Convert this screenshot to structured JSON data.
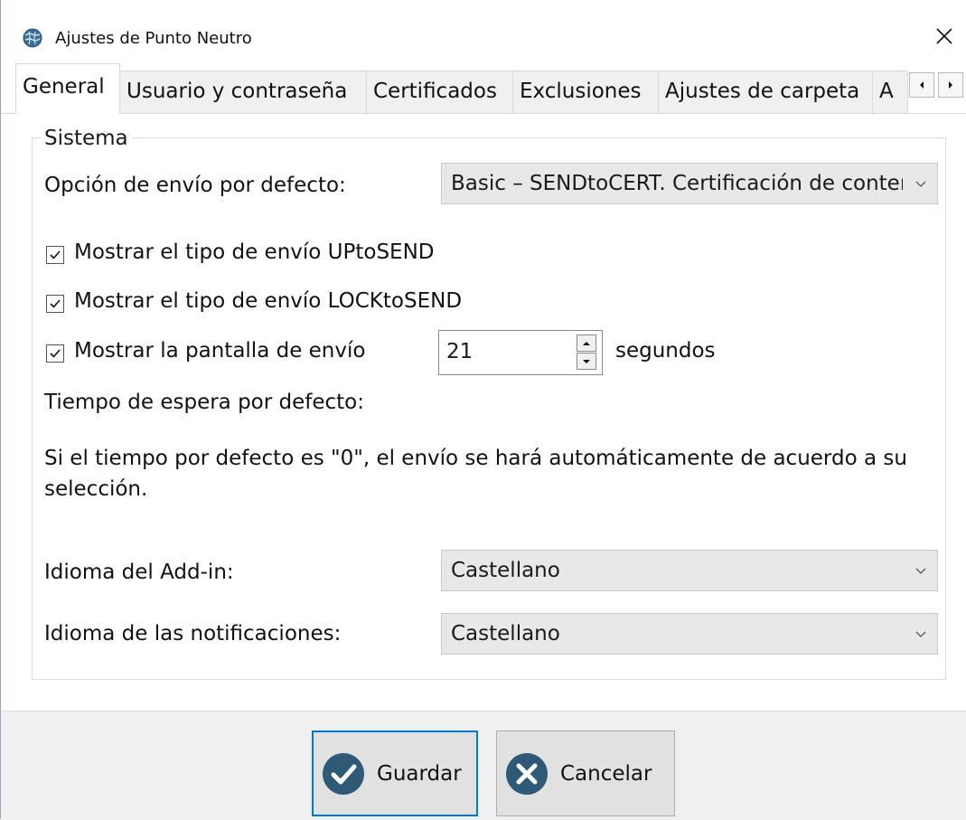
{
  "window": {
    "title": "Ajustes de Punto Neutro"
  },
  "tabs": [
    {
      "label": "General",
      "active": true
    },
    {
      "label": "Usuario y contraseña",
      "active": false
    },
    {
      "label": "Certificados",
      "active": false
    },
    {
      "label": "Exclusiones",
      "active": false
    },
    {
      "label": "Ajustes de carpeta",
      "active": false
    },
    {
      "label": "A",
      "active": false
    }
  ],
  "group": {
    "legend": "Sistema",
    "default_send_label": "Opción de envío por defecto:",
    "default_send_value": "Basic – SENDtoCERT. Certificación de contenido",
    "checkboxes": [
      {
        "label": "Mostrar el tipo de envío UPtoSEND",
        "checked": true
      },
      {
        "label": "Mostrar el tipo de envío LOCKtoSEND",
        "checked": true
      },
      {
        "label": "Mostrar la pantalla de envío",
        "checked": true
      }
    ],
    "seconds_value": "21",
    "seconds_unit": "segundos",
    "wait_label": "Tiempo de espera por defecto:",
    "info_text": "Si el tiempo por defecto es \"0\", el envío se hará automáticamente de acuerdo a su selección.",
    "addin_lang_label": "Idioma del Add-in:",
    "addin_lang_value": "Castellano",
    "notif_lang_label": "Idioma de las notificaciones:",
    "notif_lang_value": "Castellano"
  },
  "footer": {
    "save_label": "Guardar",
    "cancel_label": "Cancelar"
  },
  "colors": {
    "accent": "#0078d7",
    "button_icon": "#2f5a77"
  }
}
